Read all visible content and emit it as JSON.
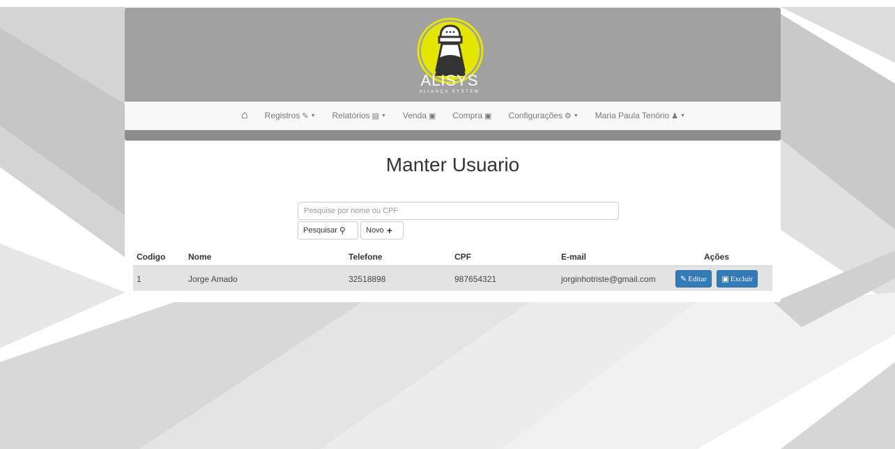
{
  "brand": {
    "name": "ALISYS",
    "tagline": "ALIANÇA SYSTEM",
    "logo_color": "#e4e600"
  },
  "navbar": {
    "home_icon": "home-icon",
    "items": [
      {
        "label": "Registros",
        "icon": "pencil-icon",
        "dropdown": true
      },
      {
        "label": "Relatórios",
        "icon": "list-icon",
        "dropdown": true
      },
      {
        "label": "Venda",
        "icon": "cart-icon",
        "dropdown": false
      },
      {
        "label": "Compra",
        "icon": "cart-icon",
        "dropdown": false
      },
      {
        "label": "Configurações",
        "icon": "gear-icon",
        "dropdown": true
      },
      {
        "label": "Maria Paula Tenório",
        "icon": "user-icon",
        "dropdown": true
      }
    ]
  },
  "page": {
    "title": "Manter Usuario"
  },
  "search": {
    "placeholder": "Pesquise por nome ou CPF",
    "value": "",
    "search_label": "Pesquisar",
    "new_label": "Novo"
  },
  "table": {
    "columns": [
      "Codigo",
      "Nome",
      "Telefone",
      "CPF",
      "E-mail",
      "Ações"
    ],
    "rows": [
      {
        "codigo": "1",
        "nome": "Jorge Amado",
        "telefone": "32518898",
        "cpf": "987654321",
        "email": "jorginhotriste@gmail.com"
      }
    ],
    "edit_label": "Editar",
    "delete_label": "Excluir"
  },
  "colors": {
    "header_bg": "#a1a1a1",
    "primary_button": "#337ab7",
    "row_bg": "#e3e3e3"
  }
}
